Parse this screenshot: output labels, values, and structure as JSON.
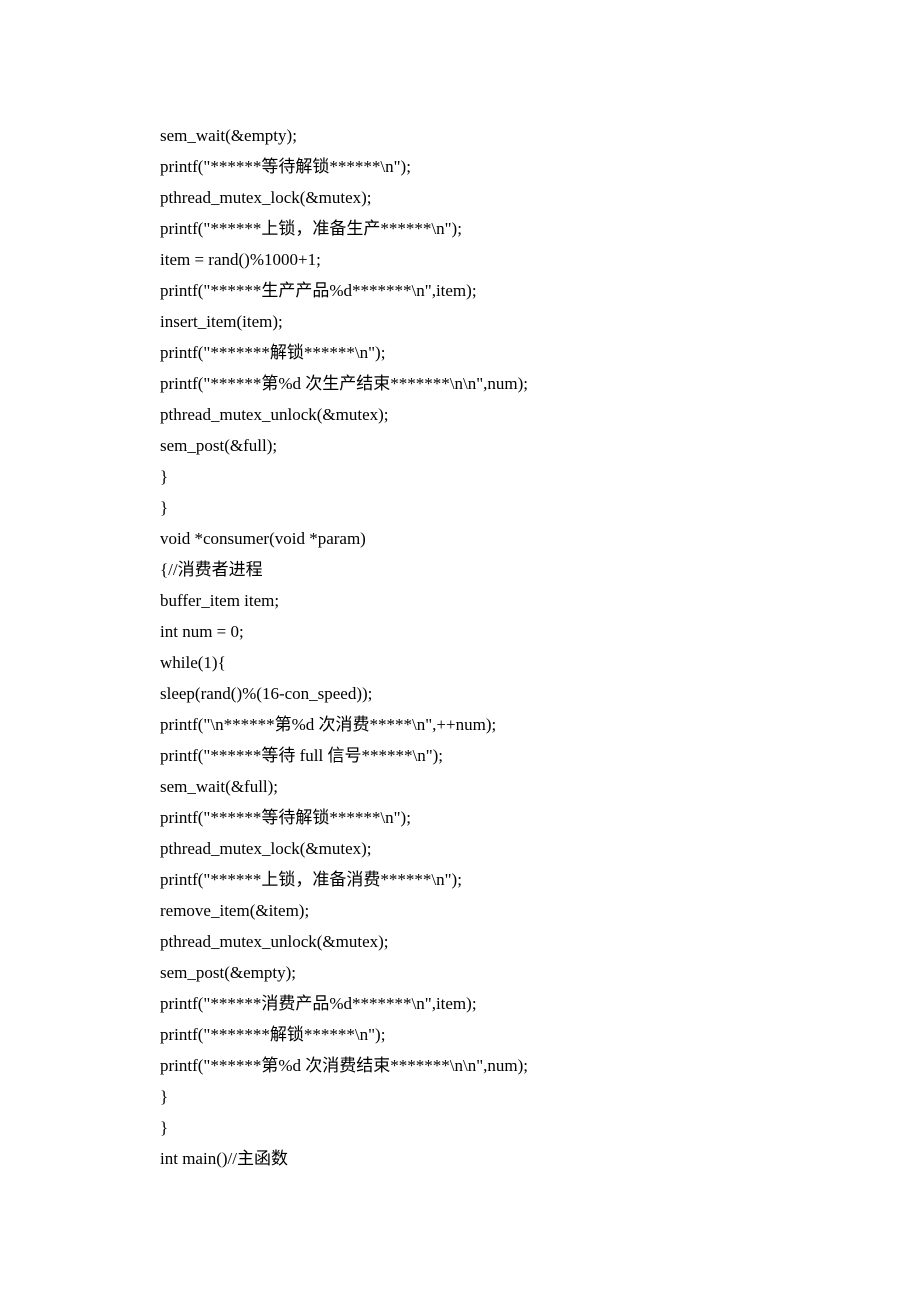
{
  "code_lines": [
    "sem_wait(&empty);",
    "printf(\"******等待解锁******\\n\");",
    "pthread_mutex_lock(&mutex);",
    "printf(\"******上锁，准备生产******\\n\");",
    "item = rand()%1000+1;",
    "printf(\"******生产产品%d*******\\n\",item);",
    "insert_item(item);",
    "printf(\"*******解锁******\\n\");",
    "printf(\"******第%d 次生产结束*******\\n\\n\",num);",
    "pthread_mutex_unlock(&mutex);",
    "sem_post(&full);",
    "}",
    "}",
    "void *consumer(void *param)",
    "{//消费者进程",
    "buffer_item item;",
    "int num = 0;",
    "while(1){",
    "sleep(rand()%(16-con_speed));",
    "printf(\"\\n******第%d 次消费*****\\n\",++num);",
    "printf(\"******等待 full 信号******\\n\");",
    "sem_wait(&full);",
    "printf(\"******等待解锁******\\n\");",
    "pthread_mutex_lock(&mutex);",
    "printf(\"******上锁，准备消费******\\n\");",
    "remove_item(&item);",
    "pthread_mutex_unlock(&mutex);",
    "sem_post(&empty);",
    "printf(\"******消费产品%d*******\\n\",item);",
    "printf(\"*******解锁******\\n\");",
    "printf(\"******第%d 次消费结束*******\\n\\n\",num);",
    "}",
    "}",
    "int main()//主函数"
  ]
}
